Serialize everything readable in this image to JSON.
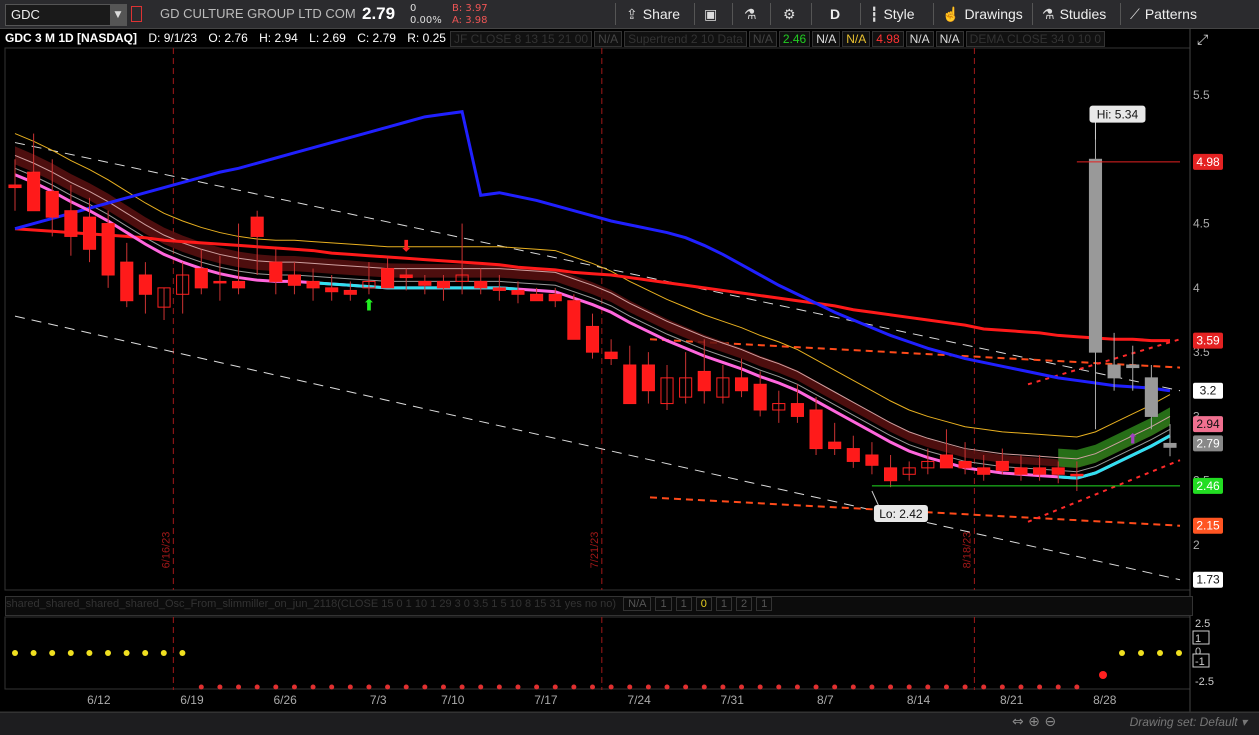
{
  "toolbar": {
    "symbol": "GDC",
    "company": "GD CULTURE GROUP LTD COM",
    "last": "2.79",
    "chg": "0",
    "chg_pct": "0.00%",
    "bid": "B: 3.97",
    "ask": "A: 3.98",
    "share": "Share",
    "aggregation": "D",
    "style": "Style",
    "drawings": "Drawings",
    "studies": "Studies",
    "patterns": "Patterns"
  },
  "info": {
    "title": "GDC 3 M 1D [NASDAQ]",
    "date": "D: 9/1/23",
    "open": "O: 2.76",
    "high": "H: 2.94",
    "low": "L: 2.69",
    "close": "C: 2.79",
    "range": "R: 0.25"
  },
  "studies_header": [
    {
      "text": "JF CLOSE 8 13 15 21 00",
      "color": "#333"
    },
    {
      "text": "N/A",
      "color": "#444"
    },
    {
      "text": "Supertrend 2 10 Data",
      "color": "#333"
    },
    {
      "text": "N/A",
      "color": "#444"
    },
    {
      "text": "2.46",
      "color": "#22cc22"
    },
    {
      "text": "N/A",
      "color": "#dddddd"
    },
    {
      "text": "N/A",
      "color": "#e8c030"
    },
    {
      "text": "4.98",
      "color": "#ff3333"
    },
    {
      "text": "N/A",
      "color": "#dddddd"
    },
    {
      "text": "N/A",
      "color": "#dddddd"
    },
    {
      "text": "DEMA CLOSE 34 0 10 0",
      "color": "#333"
    }
  ],
  "lower_study": {
    "label": "shared_shared_shared_shared_Osc_From_slimmiller_on_jun_2118(CLOSE 15 0 1 10 1 29 3 0 3.5 1 5 10 8 15 31 yes no no)",
    "values": [
      "N/A",
      "1",
      "1",
      "0",
      "1",
      "2",
      "1"
    ],
    "ticks": [
      "2.5",
      "1",
      "0",
      "-1",
      "-2.5"
    ]
  },
  "price_labels": {
    "hi": "Hi: 5.34",
    "lo": "Lo: 2.42",
    "axis": [
      "5.5",
      "5",
      "4.5",
      "4",
      "3.5",
      "3",
      "2.5",
      "2"
    ],
    "badges": [
      {
        "text": "4.98",
        "color": "#e42222"
      },
      {
        "text": "3.59",
        "color": "#e42222"
      },
      {
        "text": "3.2",
        "color": "#ffffff"
      },
      {
        "text": "2.94",
        "color": "#f07090"
      },
      {
        "text": "2.79",
        "color": "#888888"
      },
      {
        "text": "2.46",
        "color": "#22dd22"
      },
      {
        "text": "2.15",
        "color": "#ff5522"
      },
      {
        "text": "1.73",
        "color": "#ffffff"
      }
    ]
  },
  "dates": {
    "period_markers": [
      "6/16/23",
      "7/21/23",
      "8/18/23"
    ],
    "axis": [
      "6/12",
      "6/19",
      "6/26",
      "7/3",
      "7/10",
      "7/17",
      "7/24",
      "7/31",
      "8/7",
      "8/14",
      "8/21",
      "8/28"
    ]
  },
  "chart_data": {
    "type": "candlestick",
    "title": "GDC 3 M 1D [NASDAQ]",
    "ylim": [
      1.65,
      5.85
    ],
    "x": [
      "6/5",
      "6/6",
      "6/7",
      "6/8",
      "6/9",
      "6/12",
      "6/13",
      "6/14",
      "6/15",
      "6/16",
      "6/20",
      "6/21",
      "6/22",
      "6/23",
      "6/26",
      "6/27",
      "6/28",
      "6/29",
      "6/30",
      "7/3",
      "7/5",
      "7/6",
      "7/7",
      "7/10",
      "7/11",
      "7/12",
      "7/13",
      "7/14",
      "7/17",
      "7/18",
      "7/19",
      "7/20",
      "7/21",
      "7/24",
      "7/25",
      "7/26",
      "7/27",
      "7/28",
      "7/31",
      "8/1",
      "8/2",
      "8/3",
      "8/4",
      "8/7",
      "8/8",
      "8/9",
      "8/10",
      "8/11",
      "8/14",
      "8/15",
      "8/16",
      "8/17",
      "8/18",
      "8/21",
      "8/22",
      "8/23",
      "8/24",
      "8/25",
      "8/28",
      "8/29",
      "8/30",
      "8/31",
      "9/1"
    ],
    "open": [
      4.8,
      4.9,
      4.75,
      4.6,
      4.55,
      4.5,
      4.2,
      4.1,
      3.85,
      3.95,
      4.15,
      4.05,
      4.05,
      4.55,
      4.2,
      4.1,
      4.05,
      4.0,
      3.98,
      4.0,
      4.15,
      4.1,
      4.05,
      4.05,
      4.05,
      4.05,
      4.0,
      3.98,
      3.95,
      3.95,
      3.9,
      3.7,
      3.5,
      3.4,
      3.4,
      3.1,
      3.15,
      3.35,
      3.15,
      3.3,
      3.25,
      3.05,
      3.1,
      3.05,
      2.8,
      2.75,
      2.7,
      2.6,
      2.55,
      2.6,
      2.7,
      2.65,
      2.6,
      2.65,
      2.6,
      2.6,
      2.6,
      2.55,
      3.5,
      3.4,
      3.38,
      3.3,
      2.76
    ],
    "high": [
      5.0,
      5.2,
      5.0,
      4.8,
      4.7,
      4.6,
      4.35,
      4.2,
      4.0,
      4.2,
      4.3,
      4.25,
      4.5,
      4.6,
      4.3,
      4.2,
      4.15,
      4.1,
      4.05,
      4.2,
      4.25,
      4.15,
      4.1,
      4.1,
      4.5,
      4.15,
      4.1,
      4.05,
      4.0,
      4.0,
      3.95,
      3.8,
      3.6,
      3.55,
      3.5,
      3.4,
      3.5,
      3.6,
      3.4,
      3.45,
      3.35,
      3.2,
      3.25,
      3.15,
      2.95,
      2.85,
      2.8,
      2.7,
      2.65,
      2.75,
      2.9,
      2.8,
      2.7,
      2.75,
      2.7,
      2.7,
      2.65,
      2.65,
      5.34,
      3.65,
      3.55,
      3.4,
      2.94
    ],
    "low": [
      4.6,
      4.7,
      4.4,
      4.25,
      4.2,
      4.0,
      3.85,
      3.8,
      3.75,
      3.8,
      3.95,
      3.9,
      3.95,
      4.1,
      3.95,
      3.95,
      3.9,
      3.9,
      3.9,
      3.95,
      4.0,
      3.98,
      3.95,
      3.9,
      3.95,
      3.95,
      3.9,
      3.88,
      3.9,
      3.85,
      3.6,
      3.45,
      3.4,
      3.2,
      3.1,
      3.05,
      3.1,
      3.1,
      3.1,
      3.15,
      3.0,
      2.95,
      2.95,
      2.7,
      2.7,
      2.6,
      2.55,
      2.45,
      2.5,
      2.55,
      2.6,
      2.55,
      2.5,
      2.55,
      2.5,
      2.5,
      2.48,
      2.42,
      2.9,
      3.2,
      3.2,
      2.9,
      2.69
    ],
    "close": [
      4.78,
      4.6,
      4.55,
      4.4,
      4.3,
      4.1,
      3.9,
      3.95,
      4.0,
      4.1,
      4.0,
      4.05,
      4.0,
      4.4,
      4.05,
      4.02,
      4.0,
      3.97,
      3.95,
      4.05,
      4.0,
      4.08,
      4.02,
      4.0,
      4.1,
      4.0,
      3.98,
      3.95,
      3.9,
      3.9,
      3.6,
      3.5,
      3.45,
      3.1,
      3.2,
      3.3,
      3.3,
      3.2,
      3.3,
      3.2,
      3.05,
      3.1,
      3.0,
      2.75,
      2.75,
      2.65,
      2.62,
      2.5,
      2.6,
      2.65,
      2.6,
      2.6,
      2.55,
      2.58,
      2.55,
      2.55,
      2.55,
      2.55,
      5.0,
      3.3,
      3.4,
      3.0,
      2.79
    ],
    "series": [
      {
        "name": "EMA upper",
        "color": "#ff1a1a",
        "values": [
          4.46,
          4.45,
          4.44,
          4.43,
          4.42,
          4.41,
          4.4,
          4.39,
          4.37,
          4.36,
          4.35,
          4.34,
          4.33,
          4.32,
          4.31,
          4.3,
          4.29,
          4.27,
          4.26,
          4.25,
          4.24,
          4.23,
          4.22,
          4.21,
          4.2,
          4.19,
          4.18,
          4.16,
          4.15,
          4.14,
          4.12,
          4.11,
          4.1,
          4.08,
          4.06,
          4.04,
          4.02,
          4.0,
          3.98,
          3.96,
          3.94,
          3.92,
          3.9,
          3.88,
          3.86,
          3.83,
          3.81,
          3.79,
          3.77,
          3.75,
          3.73,
          3.71,
          3.68,
          3.67,
          3.66,
          3.65,
          3.63,
          3.62,
          3.61,
          3.6,
          3.6,
          3.59,
          3.59
        ]
      },
      {
        "name": "Trend",
        "color": "#2020ff",
        "values": [
          4.46,
          4.5,
          4.54,
          4.58,
          4.62,
          4.66,
          4.7,
          4.74,
          4.78,
          4.82,
          4.86,
          4.9,
          4.93,
          4.97,
          5.01,
          5.05,
          5.09,
          5.13,
          5.17,
          5.21,
          5.25,
          5.29,
          5.33,
          5.35,
          5.37,
          4.72,
          4.74,
          4.71,
          4.68,
          4.64,
          4.6,
          4.56,
          4.52,
          4.49,
          4.46,
          4.43,
          4.39,
          4.33,
          4.26,
          4.18,
          4.1,
          4.02,
          3.95,
          3.88,
          3.81,
          3.75,
          3.69,
          3.63,
          3.58,
          3.53,
          3.49,
          3.45,
          3.42,
          3.39,
          3.36,
          3.33,
          3.3,
          3.28,
          3.26,
          3.24,
          3.23,
          3.22,
          3.2
        ]
      },
      {
        "name": "Fast MA",
        "color": "#ff66dd",
        "values": [
          4.88,
          4.82,
          4.75,
          4.67,
          4.6,
          4.52,
          4.43,
          4.34,
          4.26,
          4.2,
          4.15,
          4.11,
          4.08,
          4.06,
          4.05,
          4.05,
          4.04,
          4.03,
          4.02,
          4.01,
          4.0,
          4.0,
          4.0,
          4.0,
          4.0,
          4.0,
          4.0,
          3.99,
          3.98,
          3.97,
          3.92,
          3.87,
          3.81,
          3.73,
          3.66,
          3.59,
          3.53,
          3.47,
          3.42,
          3.37,
          3.31,
          3.26,
          3.2,
          3.12,
          3.04,
          2.96,
          2.88,
          2.8,
          2.73,
          2.68,
          2.64,
          2.6,
          2.58,
          2.56,
          2.55,
          2.54,
          2.53,
          2.52,
          2.56,
          2.63,
          2.7,
          2.77,
          2.85
        ]
      }
    ]
  }
}
